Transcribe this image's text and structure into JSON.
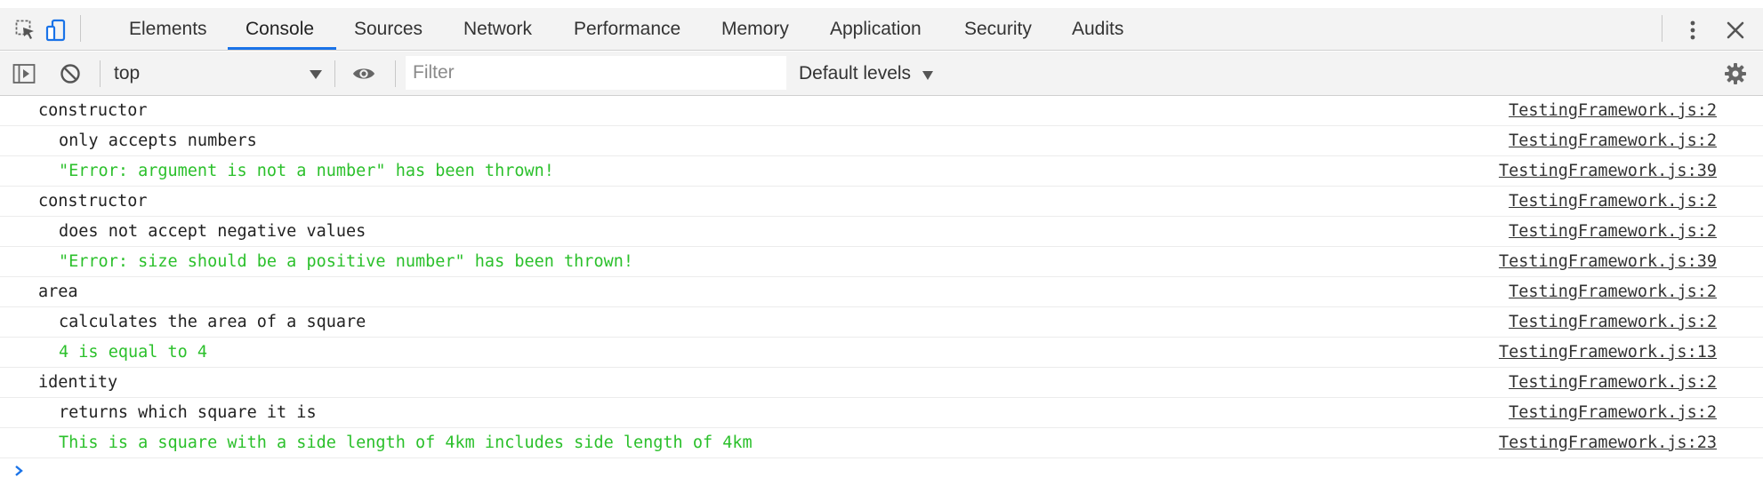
{
  "tabs": [
    {
      "label": "Elements"
    },
    {
      "label": "Console"
    },
    {
      "label": "Sources"
    },
    {
      "label": "Network"
    },
    {
      "label": "Performance"
    },
    {
      "label": "Memory"
    },
    {
      "label": "Application"
    },
    {
      "label": "Security"
    },
    {
      "label": "Audits"
    }
  ],
  "active_tab": "Console",
  "toolbar": {
    "context": "top",
    "filter_placeholder": "Filter",
    "filter_value": "",
    "levels_label": "Default levels"
  },
  "messages": [
    {
      "text": "constructor",
      "indent": 0,
      "color": "#222222",
      "source": "TestingFramework.js:2"
    },
    {
      "text": "only accepts numbers",
      "indent": 1,
      "color": "#222222",
      "source": "TestingFramework.js:2"
    },
    {
      "text": "\"Error: argument is not a number\" has been thrown!",
      "indent": 1,
      "color": "#2bc02b",
      "source": "TestingFramework.js:39"
    },
    {
      "text": "constructor",
      "indent": 0,
      "color": "#222222",
      "source": "TestingFramework.js:2"
    },
    {
      "text": "does not accept negative values",
      "indent": 1,
      "color": "#222222",
      "source": "TestingFramework.js:2"
    },
    {
      "text": "\"Error: size should be a positive number\" has been thrown!",
      "indent": 1,
      "color": "#2bc02b",
      "source": "TestingFramework.js:39"
    },
    {
      "text": "area",
      "indent": 0,
      "color": "#222222",
      "source": "TestingFramework.js:2"
    },
    {
      "text": "calculates the area of a square",
      "indent": 1,
      "color": "#222222",
      "source": "TestingFramework.js:2"
    },
    {
      "text": "4 is equal to 4",
      "indent": 1,
      "color": "#2bc02b",
      "source": "TestingFramework.js:13"
    },
    {
      "text": "identity",
      "indent": 0,
      "color": "#222222",
      "source": "TestingFramework.js:2"
    },
    {
      "text": "returns which square it is",
      "indent": 1,
      "color": "#222222",
      "source": "TestingFramework.js:2"
    },
    {
      "text": "This is a square with a side length of 4km includes side length of 4km",
      "indent": 1,
      "color": "#2bc02b",
      "source": "TestingFramework.js:23"
    }
  ],
  "icons": {
    "inspect": "inspect-element-icon",
    "device": "device-toolbar-icon",
    "more": "more-vertical-icon",
    "close": "close-icon",
    "sidebar": "show-sidebar-icon",
    "clear": "clear-console-icon",
    "eye": "live-expression-eye-icon",
    "settings": "gear-icon",
    "prompt": "console-prompt-chevron-icon"
  },
  "colors": {
    "accent": "#1a73e8",
    "success_text": "#2bc02b"
  }
}
